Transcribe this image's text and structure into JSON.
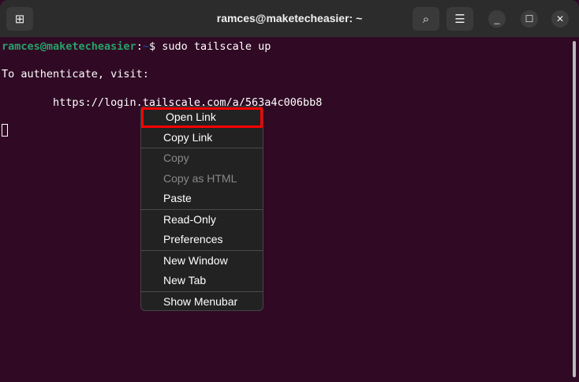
{
  "window": {
    "title": "ramces@maketecheasier: ~"
  },
  "terminal": {
    "prompt_user": "ramces@maketecheasier",
    "prompt_sep": ":",
    "prompt_path": "~",
    "prompt_symbol": "$ ",
    "command": "sudo tailscale up",
    "line2": "To authenticate, visit:",
    "line3": "        https://login.tailscale.com/a/563a4c006bb8"
  },
  "menu": {
    "items": [
      {
        "label": "Open Link",
        "enabled": true
      },
      {
        "label": "Copy Link",
        "enabled": true
      },
      {
        "label": "Copy",
        "enabled": false
      },
      {
        "label": "Copy as HTML",
        "enabled": false
      },
      {
        "label": "Paste",
        "enabled": true
      },
      {
        "label": "Read-Only",
        "enabled": true
      },
      {
        "label": "Preferences",
        "enabled": true
      },
      {
        "label": "New Window",
        "enabled": true
      },
      {
        "label": "New Tab",
        "enabled": true
      },
      {
        "label": "Show Menubar",
        "enabled": true
      }
    ]
  },
  "highlight_color": "#ff0000"
}
